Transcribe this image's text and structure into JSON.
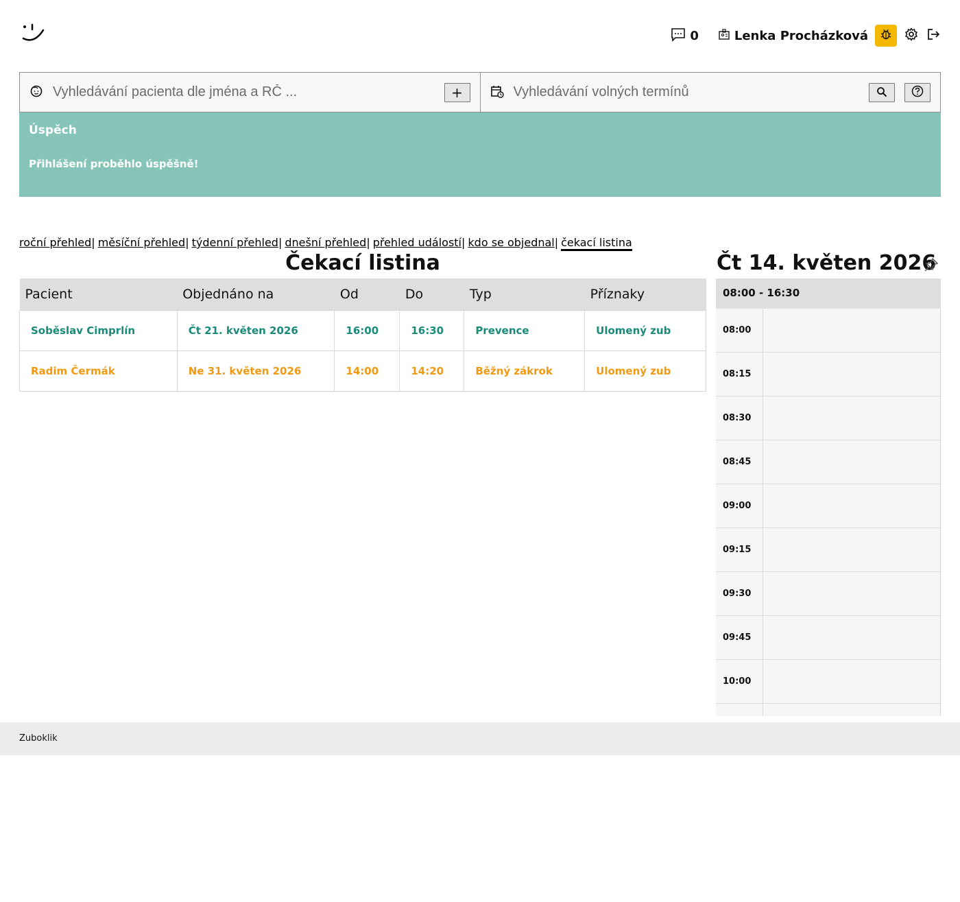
{
  "header": {
    "message_count": "0",
    "user_name": "Lenka Procházková",
    "icons": [
      "smile-logo",
      "chat-icon",
      "user-card-icon",
      "bug-icon",
      "gear-icon",
      "logout-icon"
    ]
  },
  "search": {
    "patient_placeholder": "Vyhledávání pacienta dle jména a RČ ...",
    "add_label": "+",
    "terms_placeholder": "Vyhledávání volných termínů"
  },
  "alert": {
    "title": "Úspěch",
    "message": "Přihlášení proběhlo úspěšně!"
  },
  "nav": {
    "items": [
      {
        "label": "roční přehled"
      },
      {
        "label": "měsíční přehled"
      },
      {
        "label": "týdenní přehled"
      },
      {
        "label": "dnešní přehled"
      },
      {
        "label": "přehled událostí"
      },
      {
        "label": "kdo se objednal"
      },
      {
        "label": "čekací listina"
      }
    ],
    "separator": "|"
  },
  "waiting_list": {
    "title": "Čekací listina",
    "columns": [
      "Pacient",
      "Objednáno na",
      "Od",
      "Do",
      "Typ",
      "Příznaky"
    ],
    "rows": [
      {
        "patient": "Soběslav Cimprlín",
        "date": "Čt 21. květen 2026",
        "from": "16:00",
        "to": "16:30",
        "type": "Prevence",
        "symptoms": "Ulomený zub",
        "color": "#1a8a7a"
      },
      {
        "patient": "Radim Čermák",
        "date": "Ne 31. květen 2026",
        "from": "14:00",
        "to": "14:20",
        "type": "Běžný zákrok",
        "symptoms": "Ulomený zub",
        "color": "#f09a12"
      }
    ]
  },
  "calendar": {
    "title": "Čt 14. květen 2026",
    "hours": "08:00 - 16:30",
    "slots": [
      "08:00",
      "08:15",
      "08:30",
      "08:45",
      "09:00",
      "09:15",
      "09:30",
      "09:45",
      "10:00",
      ""
    ]
  },
  "footer": {
    "text": "Zuboklik"
  },
  "colors": {
    "alert_bg": "#86c4ba",
    "bug_bg": "#f5b800",
    "green": "#1a8a7a",
    "orange": "#f09a12"
  }
}
